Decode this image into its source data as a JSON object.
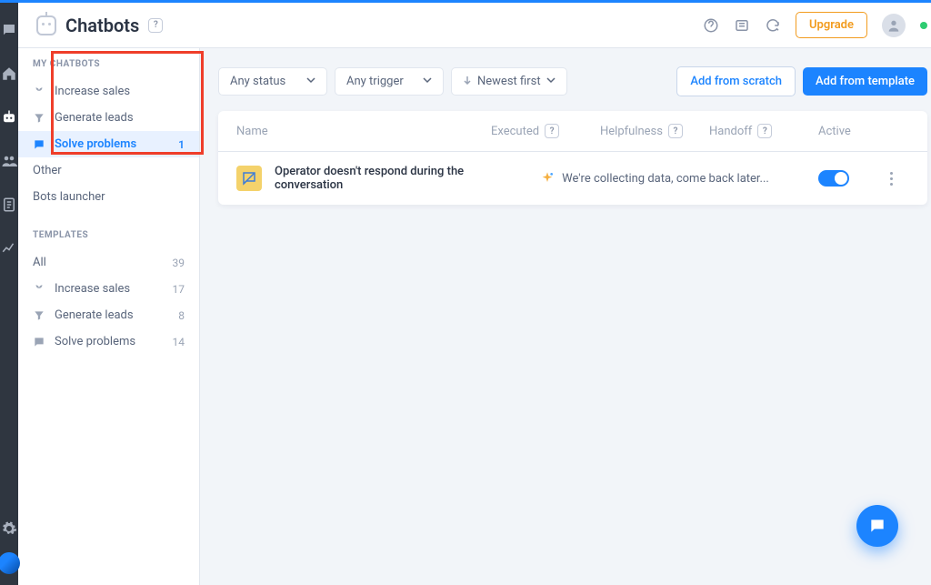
{
  "header": {
    "title": "Chatbots",
    "upgrade_label": "Upgrade"
  },
  "sidebar": {
    "my_chatbots_heading": "MY CHATBOTS",
    "templates_heading": "TEMPLATES",
    "my_chatbots": [
      {
        "label": "Increase sales",
        "count": ""
      },
      {
        "label": "Generate leads",
        "count": ""
      },
      {
        "label": "Solve problems",
        "count": "1",
        "selected": true
      },
      {
        "label": "Other",
        "count": ""
      },
      {
        "label": "Bots launcher",
        "count": ""
      }
    ],
    "templates": [
      {
        "label": "All",
        "count": "39"
      },
      {
        "label": "Increase sales",
        "count": "17"
      },
      {
        "label": "Generate leads",
        "count": "8"
      },
      {
        "label": "Solve problems",
        "count": "14"
      }
    ]
  },
  "filters": {
    "status": "Any status",
    "trigger": "Any trigger",
    "sort": "Newest first"
  },
  "actions": {
    "add_scratch": "Add from scratch",
    "add_template": "Add from template"
  },
  "table": {
    "columns": {
      "name": "Name",
      "executed": "Executed",
      "helpfulness": "Helpfulness",
      "handoff": "Handoff",
      "active": "Active"
    },
    "rows": [
      {
        "name": "Operator doesn't respond during the conversation",
        "collecting": "We're collecting data, come back later...",
        "active": true
      }
    ]
  }
}
